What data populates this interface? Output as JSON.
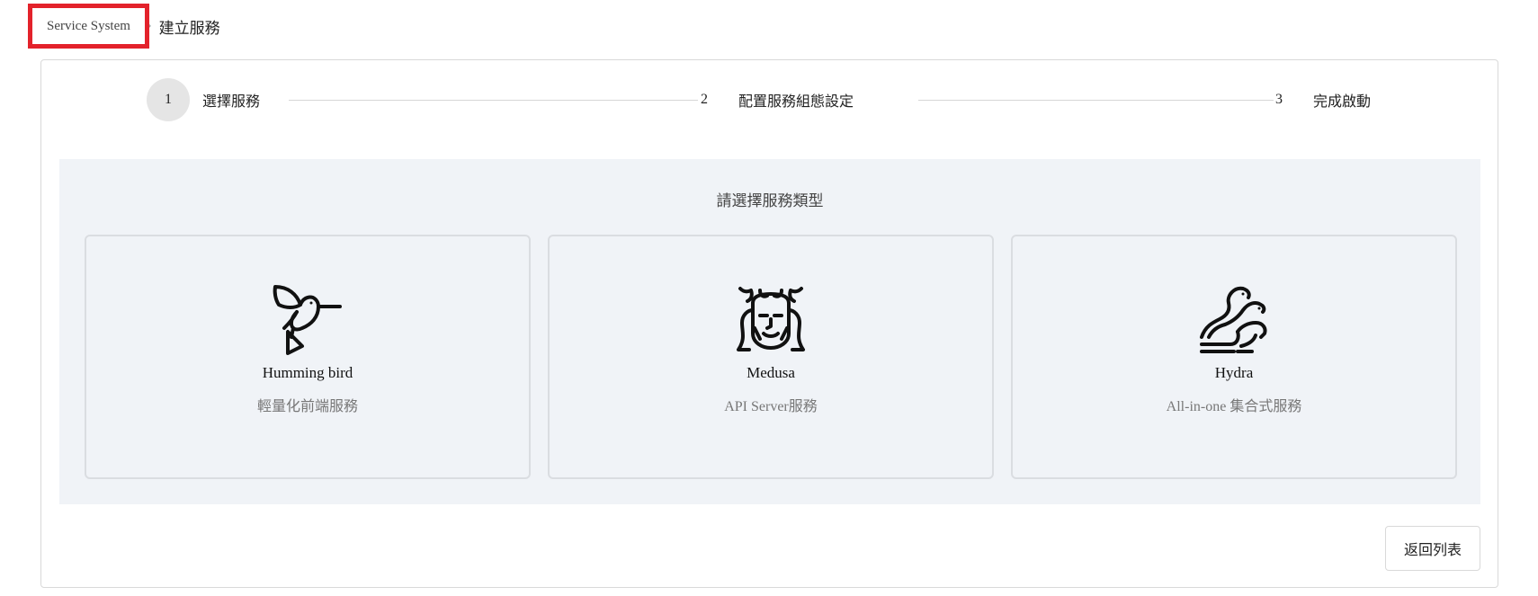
{
  "breadcrumb": {
    "root": "Service System",
    "separator": "›",
    "current": "建立服務"
  },
  "steps": [
    {
      "number": "1",
      "label": "選擇服務",
      "active": true
    },
    {
      "number": "2",
      "label": "配置服務組態設定",
      "active": false
    },
    {
      "number": "3",
      "label": "完成啟動",
      "active": false
    }
  ],
  "panel": {
    "title": "請選擇服務類型",
    "services": [
      {
        "name": "Humming bird",
        "description": "輕量化前端服務",
        "icon": "hummingbird-icon"
      },
      {
        "name": "Medusa",
        "description": "API Server服務",
        "icon": "medusa-icon"
      },
      {
        "name": "Hydra",
        "description": "All-in-one 集合式服務",
        "icon": "hydra-icon"
      }
    ]
  },
  "back_button": "返回列表",
  "colors": {
    "highlight_box": "#e3222b",
    "panel_bg": "#f0f3f7",
    "active_step_bg": "#e5e5e5"
  }
}
